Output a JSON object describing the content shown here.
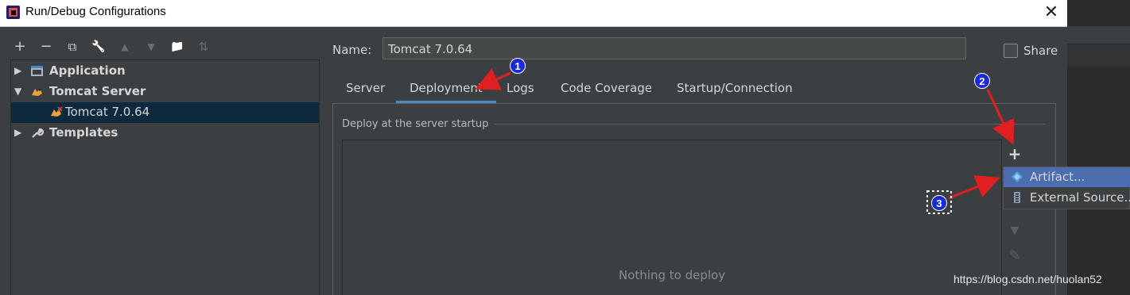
{
  "window": {
    "title": "Run/Debug Configurations",
    "close_glyph": "✕"
  },
  "toolbar": {
    "add_glyph": "+",
    "remove_glyph": "−",
    "copy_glyph": "⧉",
    "wrench_glyph": "🔧",
    "up_glyph": "▲",
    "down_glyph": "▼",
    "folder_glyph": "📁",
    "sort_glyph": "⇅"
  },
  "tree": {
    "items": [
      {
        "label": "Application",
        "icon": "application-icon",
        "expanded": false
      },
      {
        "label": "Tomcat Server",
        "icon": "tomcat-icon",
        "expanded": true
      },
      {
        "label": "Tomcat 7.0.64",
        "icon": "tomcat-icon",
        "selected": true
      },
      {
        "label": "Templates",
        "icon": "wrench-icon",
        "expanded": false
      }
    ]
  },
  "form": {
    "name_label": "Name:",
    "name_value": "Tomcat 7.0.64",
    "share_label": "Share",
    "share_checked": false
  },
  "tabs": [
    {
      "label": "Server"
    },
    {
      "label": "Deployment",
      "active": true
    },
    {
      "label": "Logs"
    },
    {
      "label": "Code Coverage"
    },
    {
      "label": "Startup/Connection"
    }
  ],
  "deploy": {
    "section_title": "Deploy at the server startup",
    "empty_text": "Nothing to deploy",
    "add_glyph": "+",
    "move_down_glyph": "▼",
    "edit_glyph": "✎"
  },
  "popup_menu": {
    "items": [
      {
        "label": "Artifact...",
        "icon": "artifact-icon",
        "selected": true
      },
      {
        "label": "External Source...",
        "icon": "external-source-icon",
        "selected": false
      }
    ]
  },
  "annotations": {
    "badge1": "1",
    "badge2": "2",
    "badge3": "3"
  },
  "watermark": "https://blog.csdn.net/huolan52",
  "colors": {
    "accent": "#4a88c7",
    "selection": "#0d293e",
    "menu_selection": "#4b6eaf",
    "annotation_arrow": "#e02020",
    "badge": "#1a2bd6"
  }
}
